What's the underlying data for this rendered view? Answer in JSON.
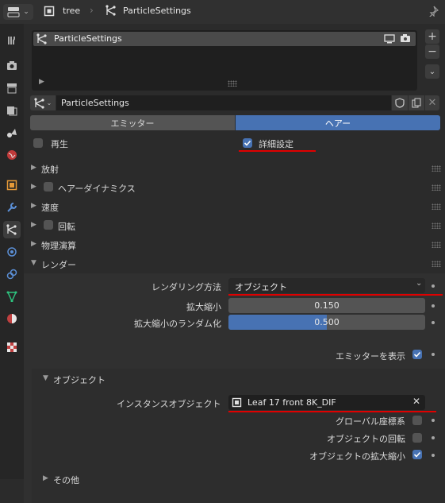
{
  "header": {
    "object_name": "tree",
    "particle_name": "ParticleSettings",
    "editor_icon": "properties-editor-icon",
    "pin_icon": "pin-icon"
  },
  "list": {
    "item_label": "ParticleSettings"
  },
  "datablock": {
    "name": "ParticleSettings"
  },
  "type_tabs": {
    "emitter": "エミッター",
    "hair": "ヘアー"
  },
  "options": {
    "playback": "再生",
    "advanced": "詳細設定"
  },
  "panels": {
    "emission": "放射",
    "hair_dynamics": "ヘアーダイナミクス",
    "velocity": "速度",
    "rotation": "回転",
    "physics": "物理演算",
    "render": "レンダー"
  },
  "render": {
    "render_as_label": "レンダリング方法",
    "render_as_value": "オブジェクト",
    "scale_label": "拡大縮小",
    "scale_value": "0.150",
    "scale_random_label": "拡大縮小のランダム化",
    "scale_random_value": "0.500",
    "scale_random_fraction": 0.5,
    "show_emitter_label": "エミッターを表示",
    "object_subpanel": "オブジェクト",
    "instance_object_label": "インスタンスオブジェクト",
    "instance_object_value": "Leaf 17 front 8K_DIF",
    "global_coords_label": "グローバル座標系",
    "object_rotation_label": "オブジェクトの回転",
    "object_scale_label": "オブジェクトの拡大縮小",
    "other_subpanel": "その他"
  },
  "colors": {
    "accent": "#4772b3",
    "annotation": "#e00000"
  }
}
